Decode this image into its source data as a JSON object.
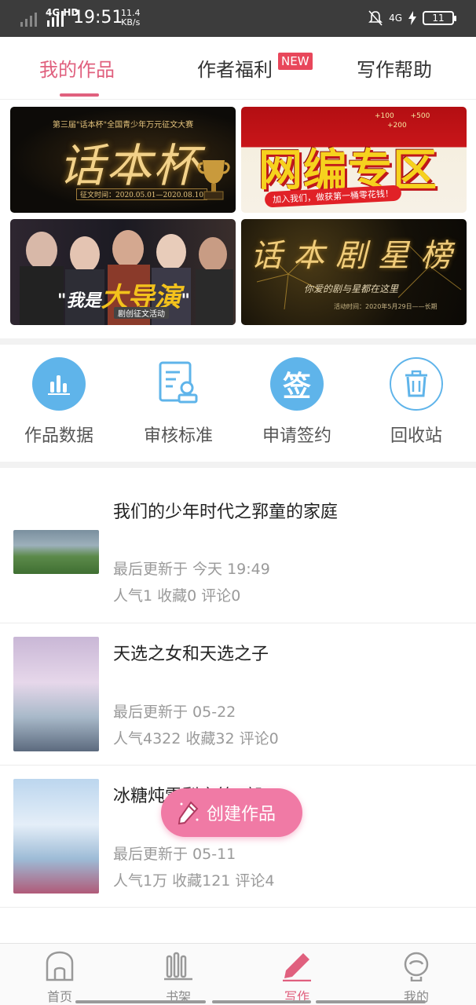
{
  "status_bar": {
    "network": "4G HD",
    "time": "19:51",
    "speed_value": "11.4",
    "speed_unit": "KB/s",
    "network_right": "4G",
    "battery": "11"
  },
  "tabs": [
    {
      "label": "我的作品",
      "active": true
    },
    {
      "label": "作者福利",
      "badge": "NEW"
    },
    {
      "label": "写作帮助"
    }
  ],
  "banners": [
    {
      "subtitle": "第三届\"话本杯\"全国青少年万元征文大赛",
      "title": "话本杯",
      "date": "征文时间：2020.05.01—2020.08.10"
    },
    {
      "title": "网编专区",
      "subtitle": "加入我们，做获第一桶零花钱！",
      "coins": [
        "+100",
        "+500",
        "+200"
      ]
    },
    {
      "title_prefix": "\"我是",
      "title_main": "大导演",
      "title_suffix": "\"",
      "tag": "剧创征文活动"
    },
    {
      "title": "话本剧星榜",
      "subtitle": "你爱的剧与星都在这里",
      "date": "活动时间：2020年5月29日——长期"
    }
  ],
  "quick_actions": [
    {
      "label": "作品数据",
      "icon": "bar-chart-icon"
    },
    {
      "label": "审核标准",
      "icon": "review-document-icon"
    },
    {
      "label": "申请签约",
      "icon": "sign-contract-icon",
      "icon_text": "签"
    },
    {
      "label": "回收站",
      "icon": "trash-icon"
    }
  ],
  "works": [
    {
      "title": "我们的少年时代之郛童的家庭",
      "update": "最后更新于 今天 19:49",
      "stats": "人气1 收藏0 评论0"
    },
    {
      "title": "天选之女和天选之子",
      "update": "最后更新于 05-22",
      "stats": "人气4322 收藏32 评论0"
    },
    {
      "title": "冰糖炖雪梨之第2部",
      "update": "最后更新于 05-11",
      "stats": "人气1万 收藏121 评论4"
    }
  ],
  "fab": {
    "label": "创建作品"
  },
  "bottom_nav": [
    {
      "label": "首页",
      "icon": "home-icon"
    },
    {
      "label": "书架",
      "icon": "bookshelf-icon"
    },
    {
      "label": "写作",
      "icon": "pencil-icon",
      "active": true
    },
    {
      "label": "我的",
      "icon": "profile-icon"
    }
  ],
  "colors": {
    "accent": "#e0607e",
    "fab": "#f07aa5",
    "quick_icon": "#5fb4ea",
    "status_bar": "#3c3c3c"
  }
}
